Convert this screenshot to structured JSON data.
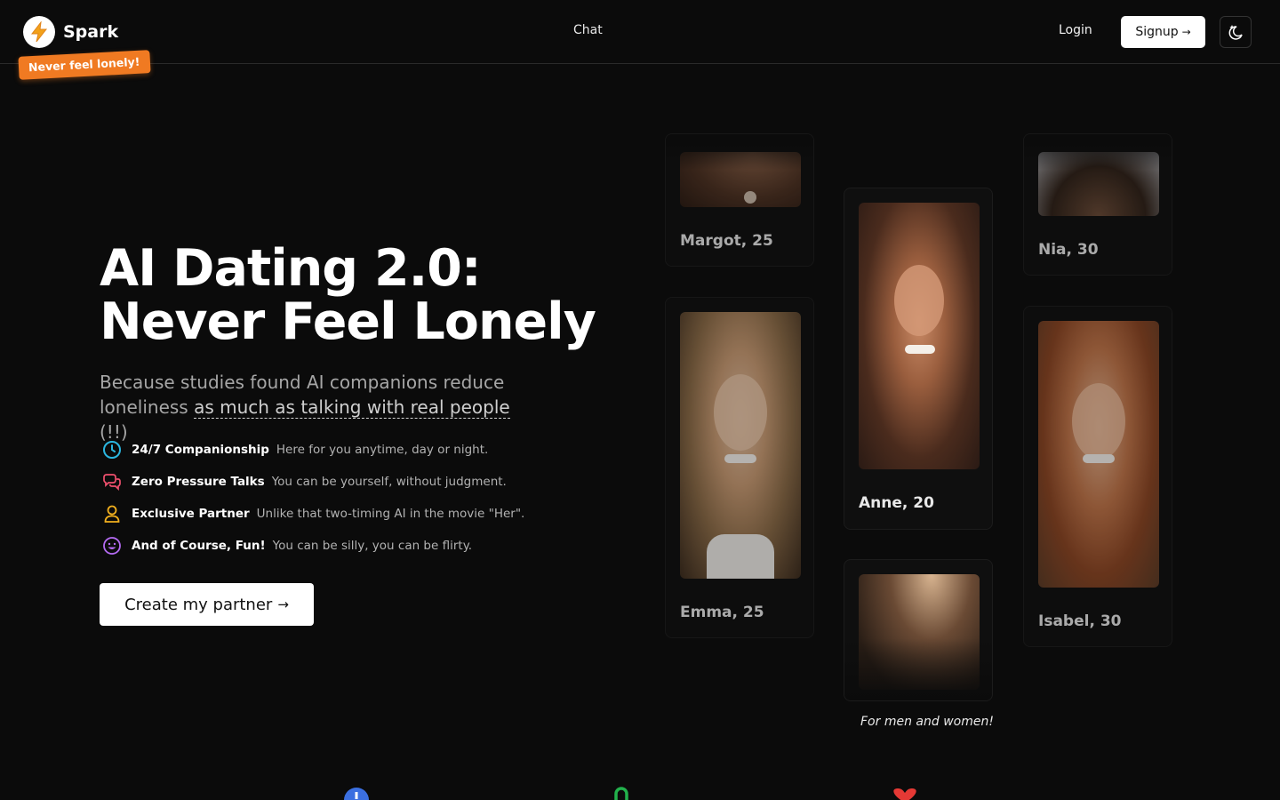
{
  "nav": {
    "brand": "Spark",
    "tagline": "Never feel lonely!",
    "chat_label": "Chat",
    "login_label": "Login",
    "signup_label": "Signup",
    "signup_arrow": "→"
  },
  "hero": {
    "title": "AI Dating 2.0: Never Feel Lonely",
    "subtitle_pre": "Because studies found AI companions reduce loneliness ",
    "subtitle_link": "as much as talking with real people",
    "subtitle_post": " (!!)",
    "features": [
      {
        "icon": "clock-icon",
        "color": "#2bb6e0",
        "title": "24/7 Companionship",
        "desc": "Here for you anytime, day or night."
      },
      {
        "icon": "chat-bubbles-icon",
        "color": "#f0506e",
        "title": "Zero Pressure Talks",
        "desc": "You can be yourself, without judgment."
      },
      {
        "icon": "user-icon",
        "color": "#f2b01e",
        "title": "Exclusive Partner",
        "desc": "Unlike that two-timing AI in the movie \"Her\"."
      },
      {
        "icon": "smiley-icon",
        "color": "#b46bf2",
        "title": "And of Course, Fun!",
        "desc": "You can be silly, you can be flirty."
      }
    ],
    "cta_label": "Create my partner",
    "cta_arrow": "→"
  },
  "profiles": [
    {
      "name": "Margot, 25"
    },
    {
      "name": "Nia, 30"
    },
    {
      "name": "Anne, 20"
    },
    {
      "name": "Emma, 25"
    },
    {
      "name": "Isabel, 30"
    }
  ],
  "caption": "For men and women!",
  "colors": {
    "accent_orange": "#f07a22",
    "background": "#0b0b0b",
    "bottom_icons": [
      "#3b6fe0",
      "#22b14c",
      "#e53935"
    ]
  }
}
